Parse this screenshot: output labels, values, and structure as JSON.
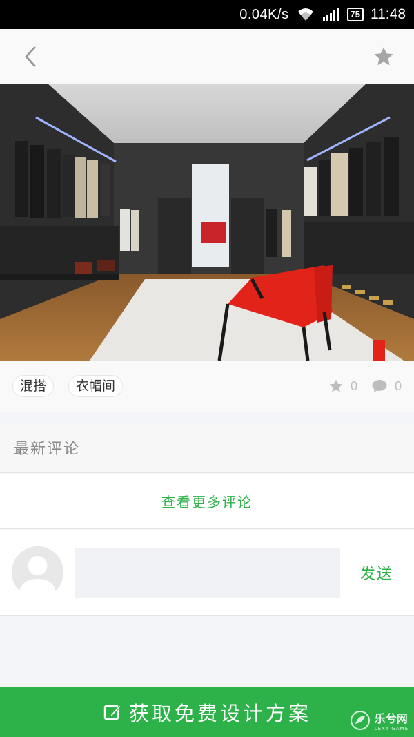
{
  "status_bar": {
    "network_speed": "0.04K/s",
    "battery": "75",
    "time": "11:48"
  },
  "header": {
    "back_icon": "chevron-left-icon",
    "favorite_icon": "star-icon"
  },
  "hero": {
    "image_subject": "walk-in-wardrobe-photo"
  },
  "tags": [
    {
      "label": "混搭"
    },
    {
      "label": "衣帽间"
    }
  ],
  "stats": {
    "favorites_count": "0",
    "comments_count": "0"
  },
  "comments": {
    "section_title": "最新评论",
    "view_more": "查看更多评论",
    "input_value": "",
    "send_label": "发送"
  },
  "cta": {
    "label": "获取免费设计方案",
    "icon": "edit-icon"
  },
  "watermark": {
    "text": "乐兮网",
    "subtext": "LEXY GAME"
  },
  "colors": {
    "accent_green": "#2db24a",
    "status_bar": "#000000",
    "header_bg": "#f9f9f9",
    "input_bg": "#f1f2f6",
    "icon_gray": "#bdbdbd"
  }
}
